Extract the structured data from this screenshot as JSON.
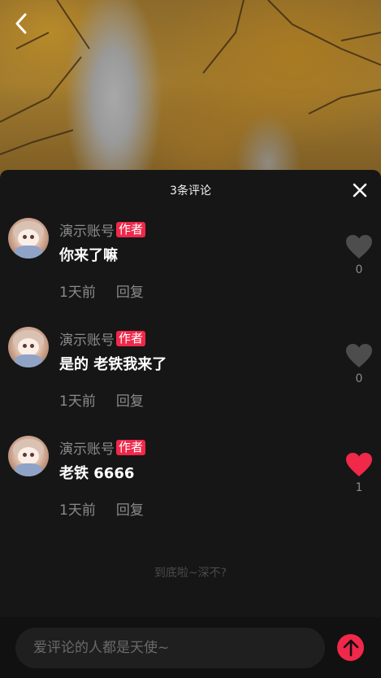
{
  "header": {
    "back_icon": "chevron-left-icon"
  },
  "sheet": {
    "title": "3条评论",
    "close_icon": "close-icon"
  },
  "comments": [
    {
      "username": "演示账号",
      "badge": "作者",
      "text": "你来了嘛",
      "time": "1天前",
      "reply": "回复",
      "likes": "0",
      "liked": false
    },
    {
      "username": "演示账号",
      "badge": "作者",
      "text": "是的 老铁我来了",
      "time": "1天前",
      "reply": "回复",
      "likes": "0",
      "liked": false
    },
    {
      "username": "演示账号",
      "badge": "作者",
      "text": "老铁 6666",
      "time": "1天前",
      "reply": "回复",
      "likes": "1",
      "liked": true
    }
  ],
  "end_text": "到底啦~深不?",
  "composer": {
    "placeholder": "爱评论的人都是天使~",
    "send_icon": "arrow-up-icon"
  },
  "colors": {
    "accent": "#f0284a",
    "background": "#161616",
    "muted_text": "#8a8a8a",
    "heart_inactive": "#4d4d4d"
  }
}
